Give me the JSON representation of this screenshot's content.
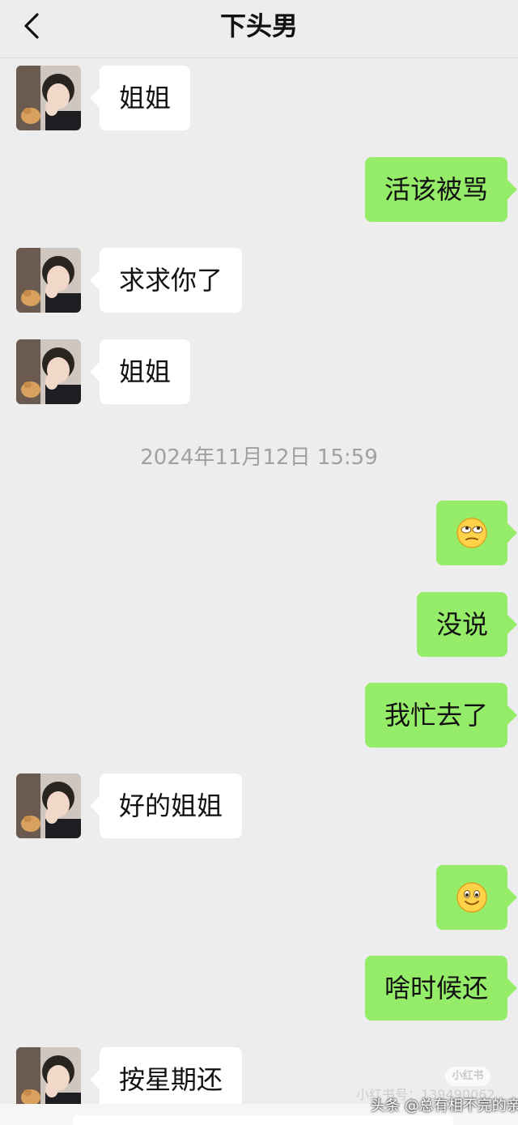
{
  "header": {
    "title": "下头男"
  },
  "messages": [
    {
      "side": "in",
      "text": "姐姐"
    },
    {
      "side": "out",
      "text": "活该被骂"
    },
    {
      "side": "in",
      "text": "求求你了"
    },
    {
      "side": "in",
      "text": "姐姐"
    },
    {
      "timestamp": "2024年11月12日 15:59"
    },
    {
      "side": "out",
      "emoji": "rolling-eyes-emoji"
    },
    {
      "side": "out",
      "text": "没说"
    },
    {
      "side": "out",
      "text": "我忙去了"
    },
    {
      "side": "in",
      "text": "好的姐姐"
    },
    {
      "side": "out",
      "emoji": "smile-emoji"
    },
    {
      "side": "out",
      "text": "啥时候还"
    },
    {
      "side": "in",
      "text": "按星期还"
    }
  ],
  "watermarks": {
    "badge": "小红书",
    "id": "小红书号：139490062",
    "source": "头条 @总有相不完的亲"
  },
  "colors": {
    "background": "#ededed",
    "incoming_bubble": "#ffffff",
    "outgoing_bubble": "#95ec69"
  }
}
